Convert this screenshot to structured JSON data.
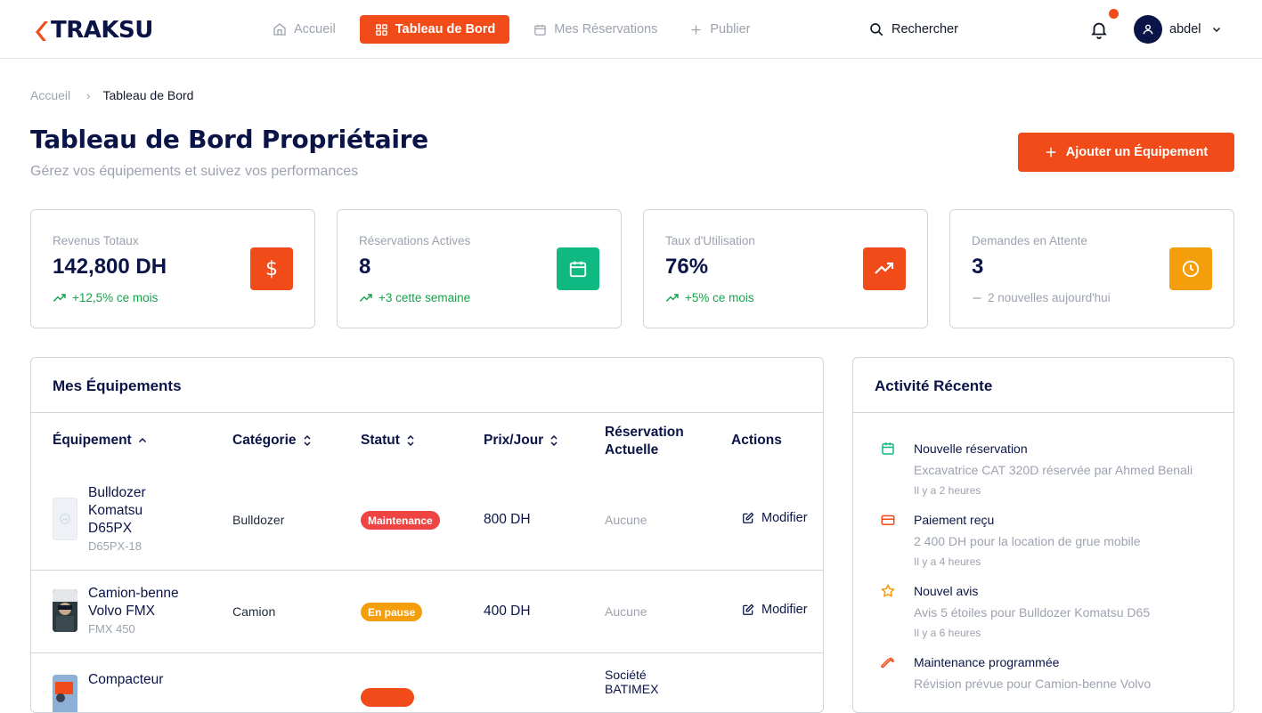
{
  "brand": {
    "name": "TRAKSU",
    "accent": "#f04b18",
    "navy": "#0b1446"
  },
  "nav": {
    "items": [
      {
        "label": "Accueil",
        "icon": "home-icon"
      },
      {
        "label": "Tableau de Bord",
        "icon": "grid-icon",
        "active": true
      },
      {
        "label": "Mes Réservations",
        "icon": "calendar-icon"
      },
      {
        "label": "Publier",
        "icon": "plus-icon"
      }
    ],
    "search_label": "Rechercher",
    "user_name": "abdel"
  },
  "breadcrumb": {
    "home": "Accueil",
    "current": "Tableau de Bord"
  },
  "header": {
    "title": "Tableau de Bord Propriétaire",
    "subtitle": "Gérez vos équipements et suivez vos performances",
    "add_button": "Ajouter un Équipement"
  },
  "stats": [
    {
      "label": "Revenus Totaux",
      "value": "142,800 DH",
      "delta": "+12,5% ce mois",
      "icon": "dollar-icon",
      "color": "#f04b18"
    },
    {
      "label": "Réservations Actives",
      "value": "8",
      "delta": "+3 cette semaine",
      "icon": "calendar-icon",
      "color": "#10b981"
    },
    {
      "label": "Taux d'Utilisation",
      "value": "76%",
      "delta": "+5% ce mois",
      "icon": "trend-up-icon",
      "color": "#f04b18"
    },
    {
      "label": "Demandes en Attente",
      "value": "3",
      "delta": "2 nouvelles aujourd'hui",
      "icon": "clock-icon",
      "color": "#f59e0b"
    }
  ],
  "equipment": {
    "title": "Mes Équipements",
    "columns": {
      "equipment": "Équipement",
      "category": "Catégorie",
      "status": "Statut",
      "price": "Prix/Jour",
      "reservation": "Réservation Actuelle",
      "actions": "Actions"
    },
    "rows": [
      {
        "name": "Bulldozer Komatsu D65PX",
        "model": "D65PX-18",
        "category": "Bulldozer",
        "status": "Maintenance",
        "status_color": "#ef4444",
        "price": "800 DH",
        "reservation": "Aucune",
        "action": "Modifier"
      },
      {
        "name": "Camion-benne Volvo FMX",
        "model": "FMX 450",
        "category": "Camion",
        "status": "En pause",
        "status_color": "#f59e0b",
        "price": "400 DH",
        "reservation": "Aucune",
        "action": "Modifier"
      },
      {
        "name": "Compacteur",
        "reservation": "Société BATIMEX"
      }
    ]
  },
  "activity": {
    "title": "Activité Récente",
    "items": [
      {
        "title": "Nouvelle réservation",
        "desc": "Excavatrice CAT 320D réservée par Ahmed Benali",
        "time": "Il y a 2 heures",
        "icon": "calendar-icon",
        "color": "#10b981"
      },
      {
        "title": "Paiement reçu",
        "desc": "2 400 DH pour la location de grue mobile",
        "time": "Il y a 4 heures",
        "icon": "credit-card-icon",
        "color": "#f04b18"
      },
      {
        "title": "Nouvel avis",
        "desc": "Avis 5 étoiles pour Bulldozer Komatsu D65",
        "time": "Il y a 6 heures",
        "icon": "star-icon",
        "color": "#f59e0b"
      },
      {
        "title": "Maintenance programmée",
        "desc": "Révision prévue pour Camion-benne Volvo",
        "icon": "wrench-icon",
        "color": "#f04b18"
      }
    ]
  }
}
